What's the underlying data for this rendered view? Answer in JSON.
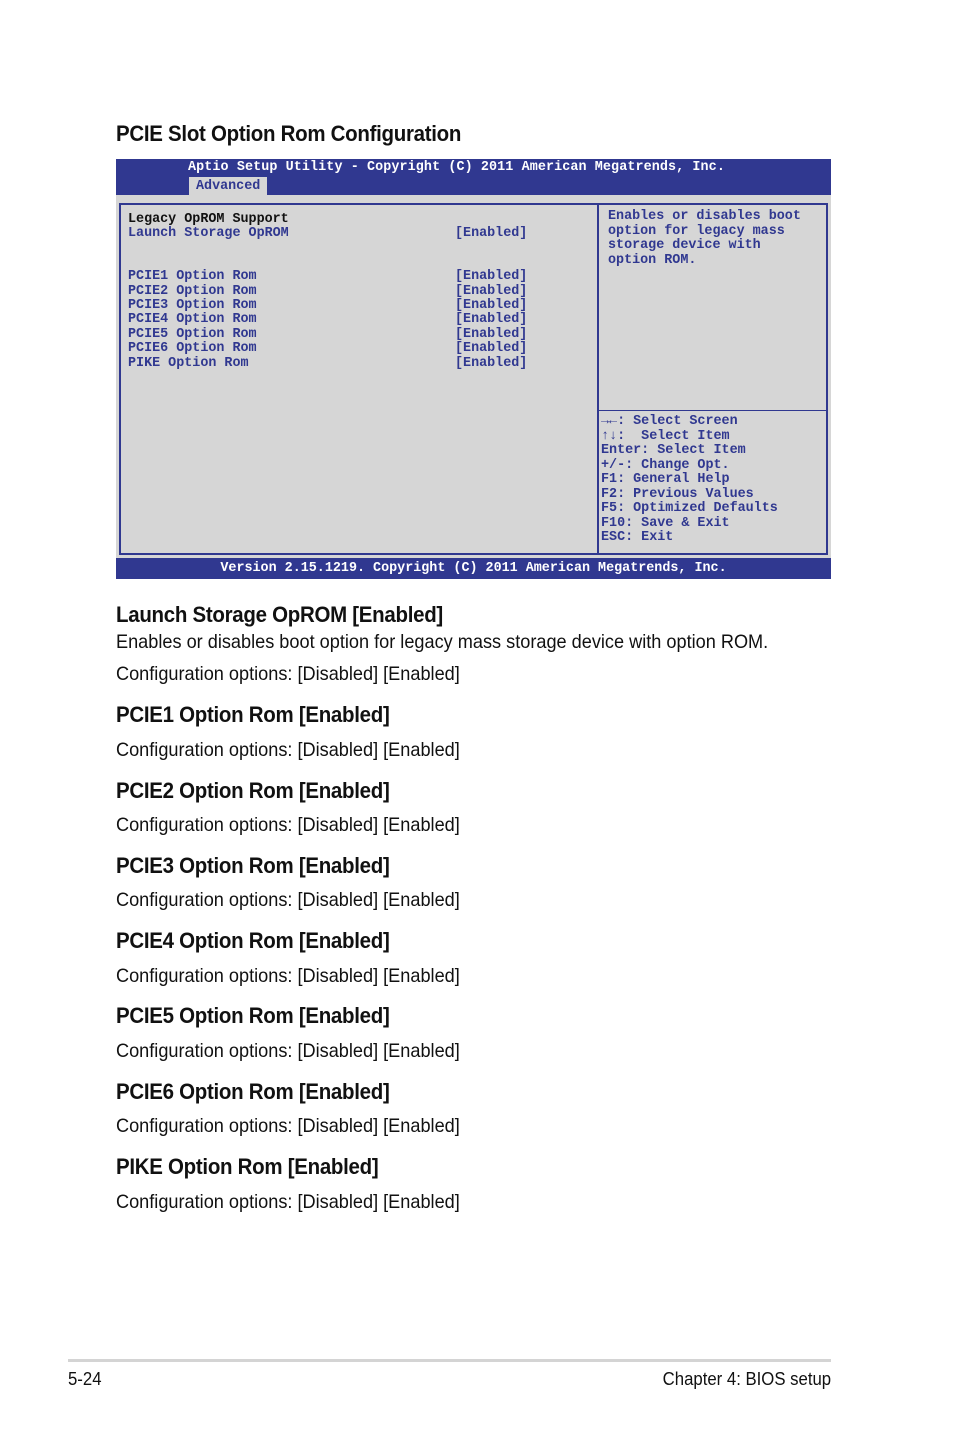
{
  "page_title": "PCIE Slot Option Rom Configuration",
  "bios": {
    "title": "Aptio Setup Utility - Copyright (C) 2011 American Megatrends, Inc.",
    "active_tab": "Advanced",
    "heading": "Legacy OpROM Support",
    "items": [
      {
        "label": "Launch Storage OpROM",
        "value": "[Enabled]"
      },
      {
        "label": "PCIE1 Option Rom",
        "value": "[Enabled]"
      },
      {
        "label": "PCIE2 Option Rom",
        "value": "[Enabled]"
      },
      {
        "label": "PCIE3 Option Rom",
        "value": "[Enabled]"
      },
      {
        "label": "PCIE4 Option Rom",
        "value": "[Enabled]"
      },
      {
        "label": "PCIE5 Option Rom",
        "value": "[Enabled]"
      },
      {
        "label": "PCIE6 Option Rom",
        "value": "[Enabled]"
      },
      {
        "label": "PIKE Option Rom",
        "value": "[Enabled]"
      }
    ],
    "help_text": "Enables or disables boot\noption for legacy mass\nstorage device with\noption ROM.",
    "keys": [
      "→←: Select Screen",
      "↑↓:  Select Item",
      "Enter: Select Item",
      "+/-: Change Opt.",
      "F1: General Help",
      "F2: Previous Values",
      "F5: Optimized Defaults",
      "F10: Save & Exit",
      "ESC: Exit"
    ],
    "footer": "Version 2.15.1219. Copyright (C) 2011 American Megatrends, Inc.",
    "colors": {
      "accent": "#303890",
      "background": "#d6d6d6"
    }
  },
  "sections": [
    {
      "title": "Launch Storage OpROM [Enabled]",
      "description": "Enables or disables boot option for legacy mass storage device with option ROM.",
      "options": "Configuration options: [Disabled] [Enabled]"
    },
    {
      "title": "PCIE1 Option Rom [Enabled]",
      "options": "Configuration options: [Disabled] [Enabled]"
    },
    {
      "title": "PCIE2 Option Rom [Enabled]",
      "options": "Configuration options: [Disabled] [Enabled]"
    },
    {
      "title": "PCIE3 Option Rom [Enabled]",
      "options": "Configuration options: [Disabled] [Enabled]"
    },
    {
      "title": "PCIE4 Option Rom [Enabled]",
      "options": "Configuration options: [Disabled] [Enabled]"
    },
    {
      "title": "PCIE5 Option Rom [Enabled]",
      "options": "Configuration options: [Disabled] [Enabled]"
    },
    {
      "title": "PCIE6 Option Rom [Enabled]",
      "options": "Configuration options: [Disabled] [Enabled]"
    },
    {
      "title": "PIKE Option Rom [Enabled]",
      "options": "Configuration options: [Disabled] [Enabled]"
    }
  ],
  "footer": {
    "page_number": "5-24",
    "chapter": "Chapter 4: BIOS setup"
  }
}
